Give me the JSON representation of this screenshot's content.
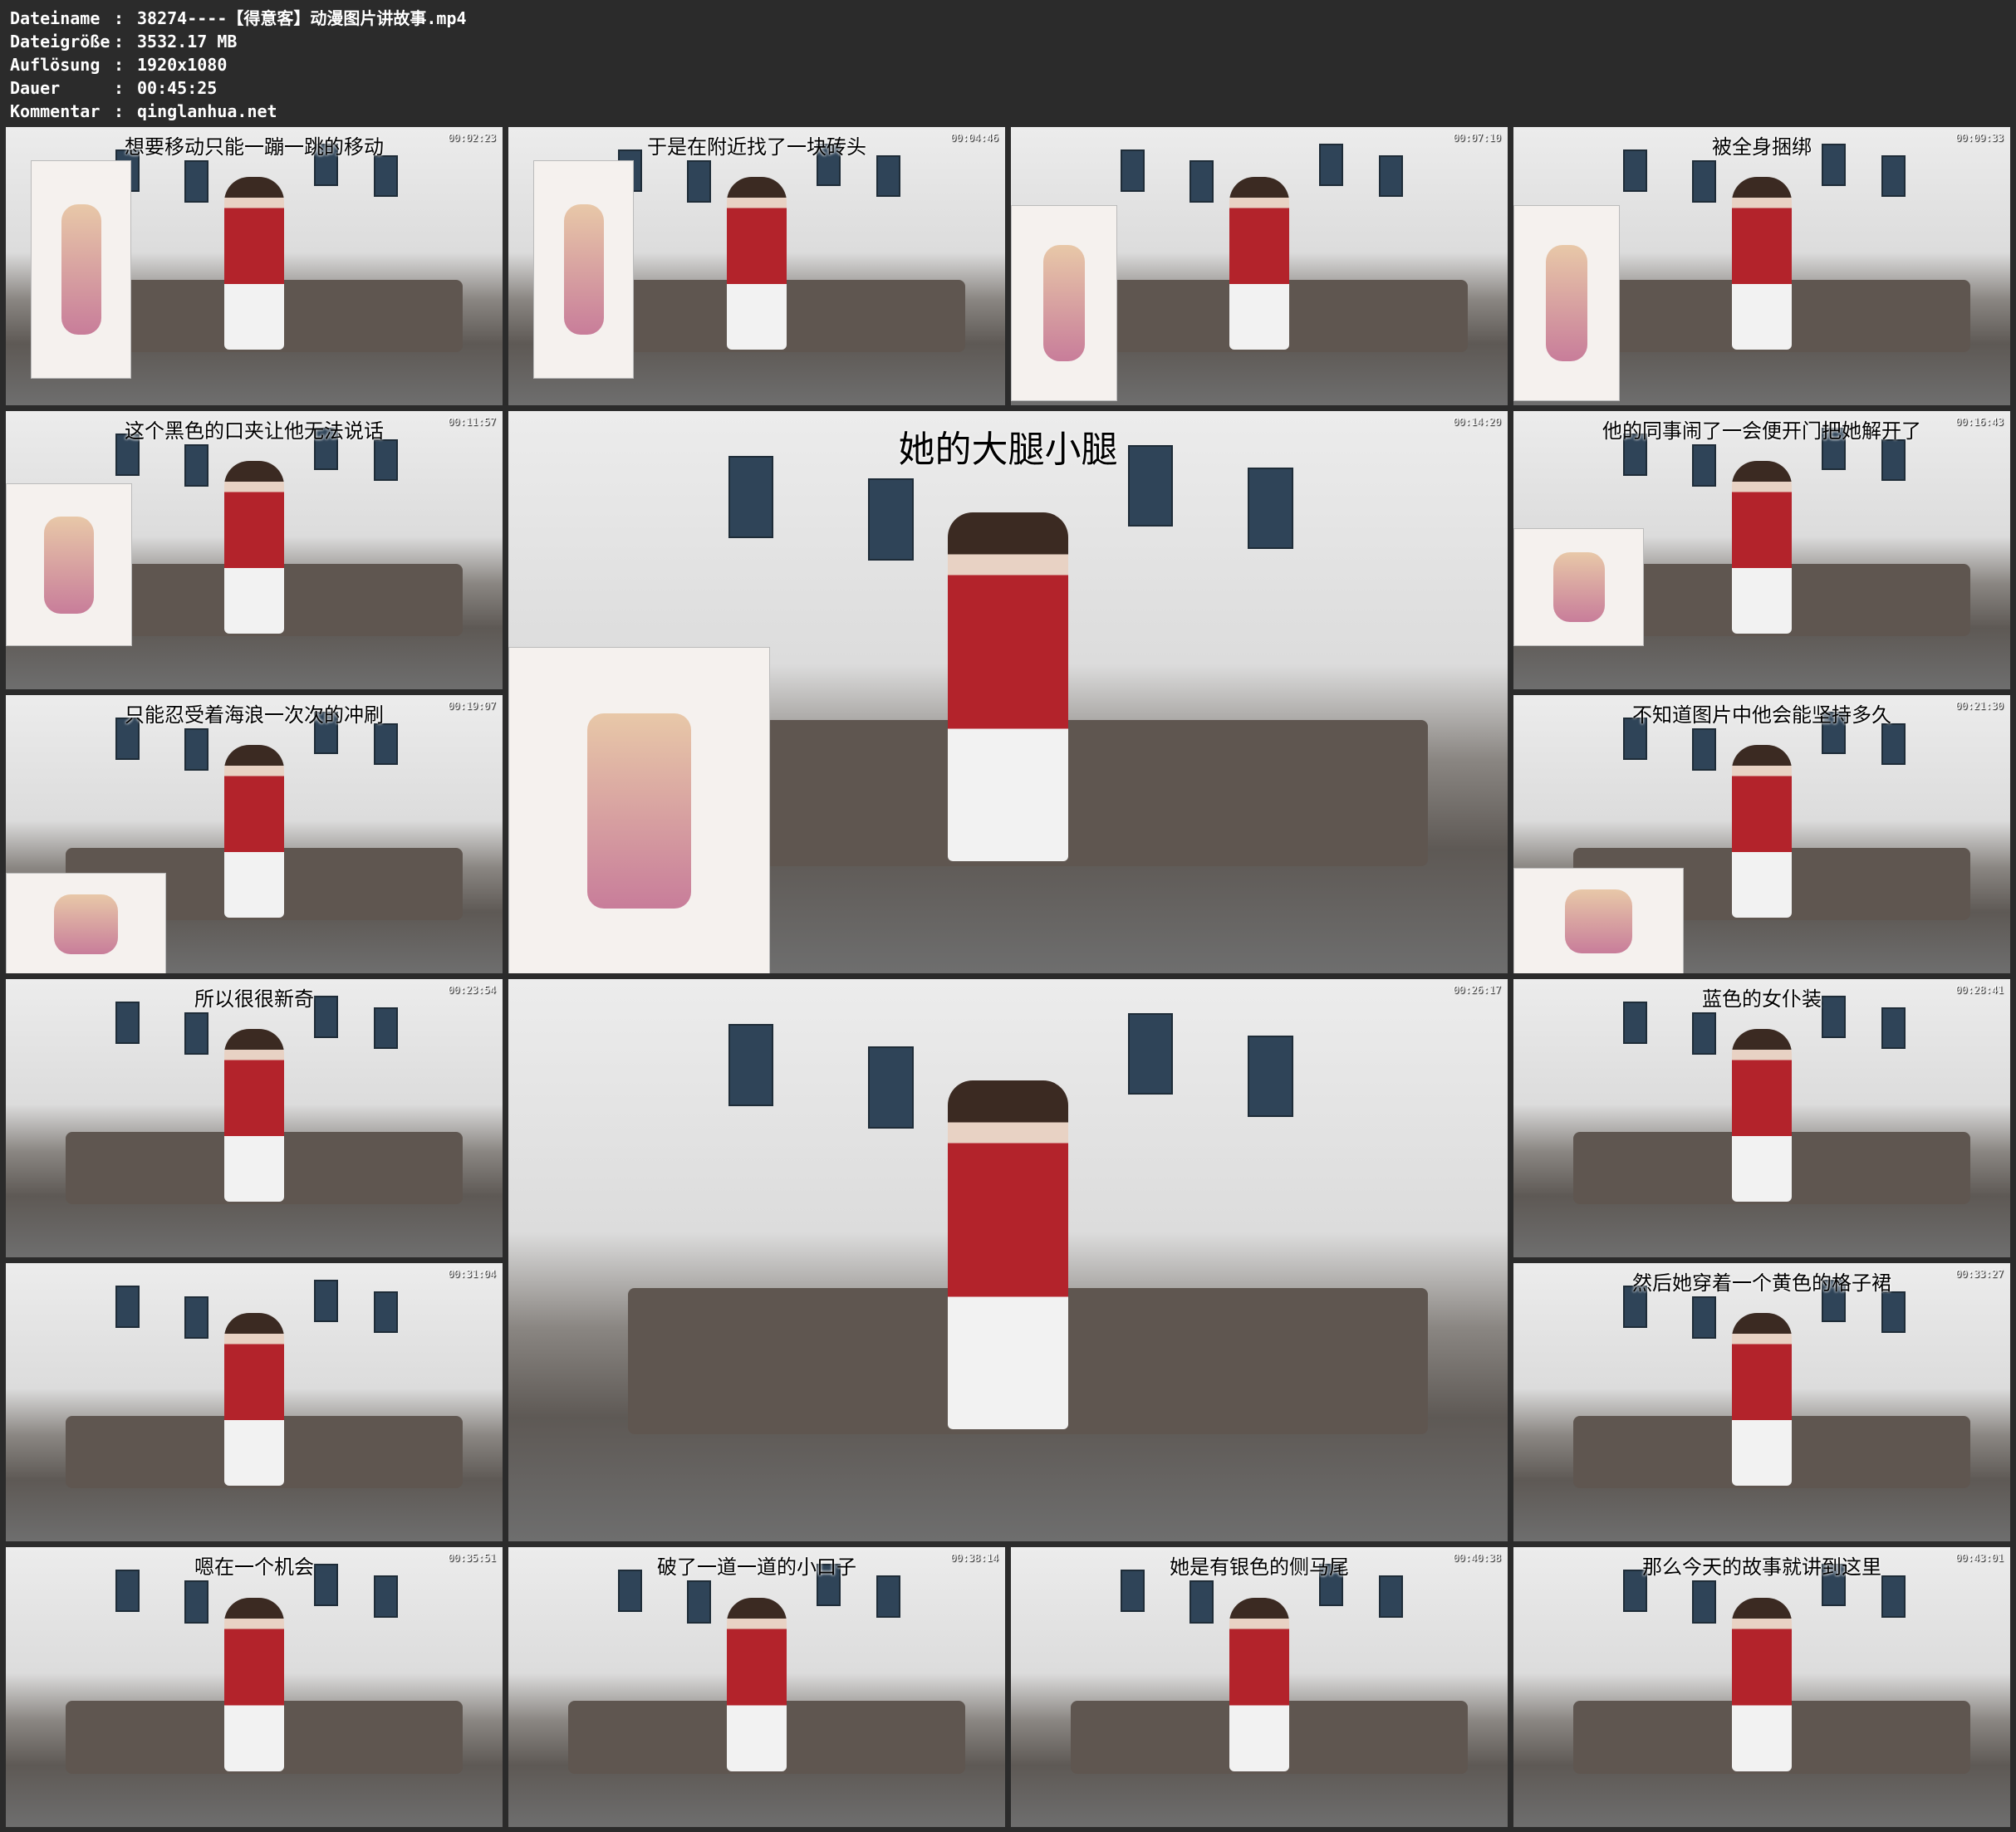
{
  "meta": [
    {
      "key": "Dateiname",
      "value": "38274----【得意客】动漫图片讲故事.mp4"
    },
    {
      "key": "Dateigröße",
      "value": "3532.17 MB"
    },
    {
      "key": "Auflösung",
      "value": "1920x1080"
    },
    {
      "key": "Dauer",
      "value": "00:45:25"
    },
    {
      "key": "Kommentar",
      "value": "qinglanhua.net"
    }
  ],
  "separator": ":",
  "tiles": [
    {
      "caption": "想要移动只能一蹦一跳的移动",
      "time": "00:02:23"
    },
    {
      "caption": "于是在附近找了一块砖头",
      "time": "00:04:46"
    },
    {
      "caption": "",
      "time": "00:07:10"
    },
    {
      "caption": "被全身捆绑",
      "time": "00:09:33"
    },
    {
      "caption": "这个黑色的口夹让他无法说话",
      "time": "00:11:57"
    },
    {
      "caption": "她的大腿小腿",
      "time": "00:14:20"
    },
    {
      "caption": "他的同事闹了一会便开门把她解开了",
      "time": "00:16:43"
    },
    {
      "caption": "只能忍受着海浪一次次的冲刷",
      "time": "00:19:07"
    },
    {
      "caption": "不知道图片中他会能坚持多久",
      "time": "00:21:30"
    },
    {
      "caption": "所以很很新奇",
      "time": "00:23:54"
    },
    {
      "caption": "",
      "time": "00:26:17"
    },
    {
      "caption": "蓝色的女仆装",
      "time": "00:28:41"
    },
    {
      "caption": "",
      "time": "00:31:04"
    },
    {
      "caption": "然后她穿着一个黄色的格子裙",
      "time": "00:33:27"
    },
    {
      "caption": "嗯在一个机会",
      "time": "00:35:51"
    },
    {
      "caption": "破了一道一道的小口子",
      "time": "00:38:14"
    },
    {
      "caption": "她是有银色的侧马尾",
      "time": "00:40:38"
    },
    {
      "caption": "那么今天的故事就讲到这里",
      "time": "00:43:01"
    }
  ]
}
